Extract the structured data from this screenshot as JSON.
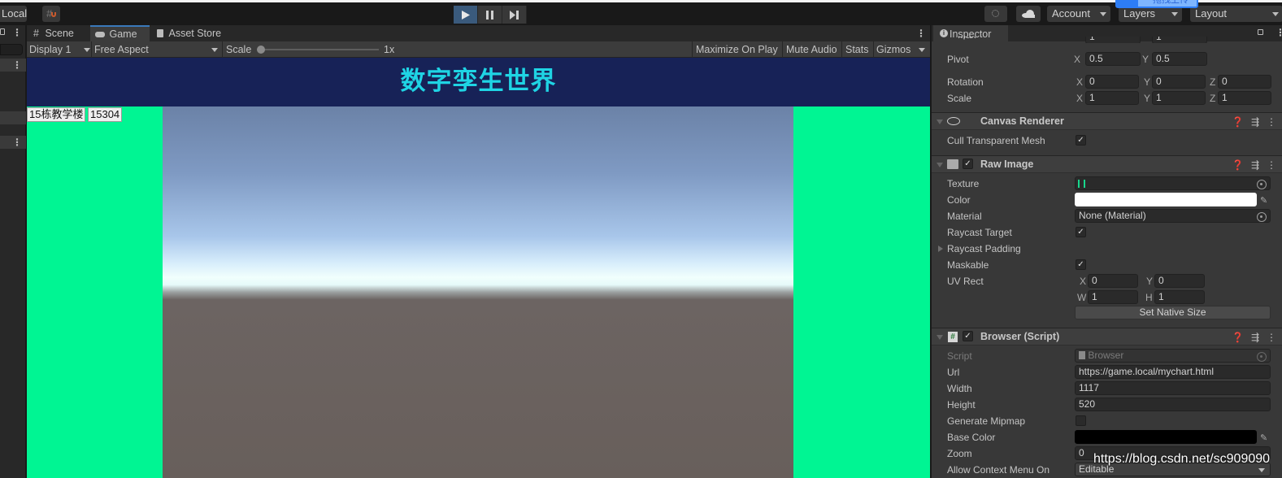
{
  "toolbar": {
    "local_label": "Local",
    "account_label": "Account",
    "layers_label": "Layers",
    "layout_label": "Layout",
    "upload_tag_text": "拖拽上传",
    "play_state": "playing"
  },
  "scene_tabs": [
    {
      "label": "Scene",
      "icon": "grid-icon",
      "active": false
    },
    {
      "label": "Game",
      "icon": "gamepad-icon",
      "active": true
    },
    {
      "label": "Asset Store",
      "icon": "bag-icon",
      "active": false
    }
  ],
  "game_bar": {
    "display": "Display 1",
    "aspect": "Free Aspect",
    "scale_label": "Scale",
    "scale_value": "1x",
    "scale_fraction": 0,
    "maximize_on_play": "Maximize On Play",
    "mute_audio": "Mute Audio",
    "stats": "Stats",
    "gizmos": "Gizmos"
  },
  "game_view": {
    "banner_title": "数字孪生世界",
    "building_label": "15栋教学楼",
    "room_label": "15304",
    "banner_color": "#172257",
    "title_color": "#1fd4e4",
    "background_color": "#00f593"
  },
  "inspector": {
    "tab_label": "Inspector",
    "anchors_max": {
      "label": "Max",
      "x": "1",
      "y": "1"
    },
    "pivot": {
      "label": "Pivot",
      "x": "0.5",
      "y": "0.5"
    },
    "rotation": {
      "label": "Rotation",
      "x": "0",
      "y": "0",
      "z": "0"
    },
    "scale": {
      "label": "Scale",
      "x": "1",
      "y": "1",
      "z": "1"
    },
    "canvas_renderer": {
      "title": "Canvas Renderer",
      "cull_label": "Cull Transparent Mesh",
      "cull_checked": true
    },
    "raw_image": {
      "title": "Raw Image",
      "enabled": true,
      "texture_label": "Texture",
      "color_label": "Color",
      "color_value": "#ffffff",
      "material_label": "Material",
      "material_value": "None (Material)",
      "raycast_target_label": "Raycast Target",
      "raycast_target_checked": true,
      "raycast_padding_label": "Raycast Padding",
      "maskable_label": "Maskable",
      "maskable_checked": true,
      "uv_rect_label": "UV Rect",
      "uv": {
        "x": "0",
        "y": "0",
        "w": "1",
        "h": "1"
      },
      "set_native_size": "Set Native Size"
    },
    "browser_script": {
      "title": "Browser (Script)",
      "enabled": true,
      "script_label": "Script",
      "script_value": "Browser",
      "url_label": "Url",
      "url_value": "https://game.local/mychart.html",
      "width_label": "Width",
      "width_value": "1117",
      "height_label": "Height",
      "height_value": "520",
      "mipmap_label": "Generate Mipmap",
      "mipmap_checked": false,
      "base_color_label": "Base Color",
      "base_color_value": "#000000",
      "zoom_label": "Zoom",
      "zoom_value": "0",
      "context_menu_label": "Allow Context Menu On",
      "context_menu_value": "Editable"
    }
  },
  "watermark": "https://blog.csdn.net/sc909090"
}
